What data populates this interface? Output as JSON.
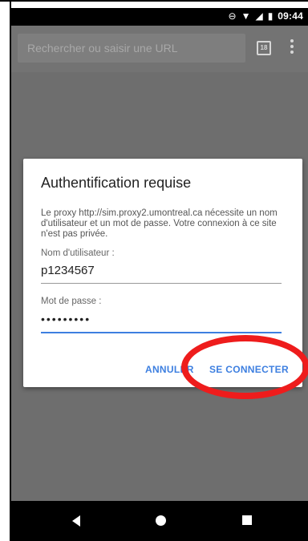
{
  "status_bar": {
    "time": "09:44",
    "icons": [
      "dnd-icon",
      "wifi-icon",
      "signal-icon",
      "battery-icon"
    ]
  },
  "toolbar": {
    "url_placeholder": "Rechercher ou saisir une URL",
    "tab_count": "18"
  },
  "dialog": {
    "title": "Authentification requise",
    "message": "Le proxy http://sim.proxy2.umontreal.ca nécessite un nom d'utilisateur et un mot de passe. Votre connexion à ce site n'est pas privée.",
    "username_label": "Nom d'utilisateur :",
    "username_value": "p1234567",
    "password_label": "Mot de passe :",
    "password_value": "•••••••••",
    "cancel_label": "ANNULER",
    "connect_label": "SE CONNECTER"
  },
  "colors": {
    "accent": "#3d7fe0",
    "highlight": "#ee1c1c"
  }
}
